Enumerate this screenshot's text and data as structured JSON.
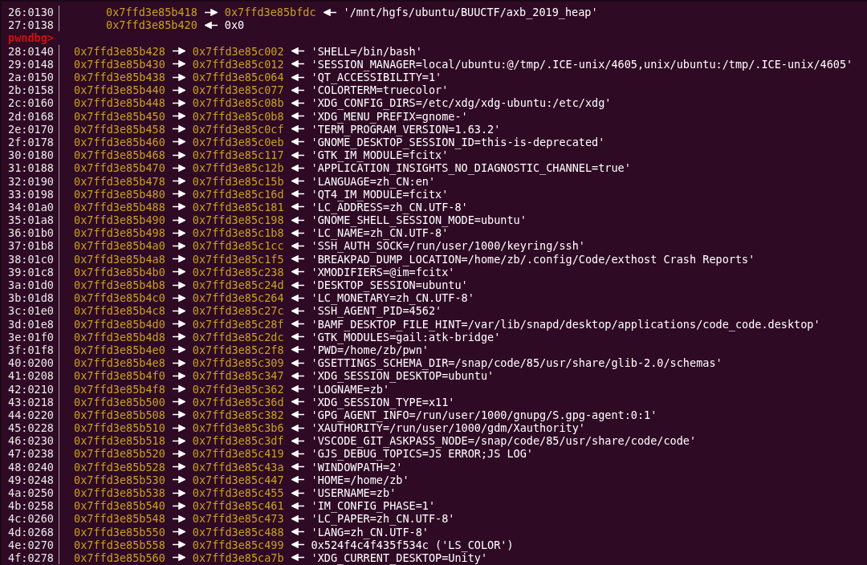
{
  "terminal": {
    "lines": [
      {
        "kind": "nested",
        "offset": "26:0130",
        "address": "0x7ffd3e85b418",
        "target": "0x7ffd3e85bfdc",
        "value": "'/mnt/hgfs/ubuntu/BUUCTF/axb_2019_heap'"
      },
      {
        "kind": "nested",
        "offset": "27:0138",
        "address": "0x7ffd3e85b420",
        "value": "0x0"
      },
      {
        "kind": "prompt",
        "text": "pwndbg>"
      },
      {
        "kind": "stack",
        "offset": "28:0140",
        "address": "0x7ffd3e85b428",
        "target": "0x7ffd3e85c002",
        "value": "'SHELL=/bin/bash'"
      },
      {
        "kind": "stack",
        "offset": "29:0148",
        "address": "0x7ffd3e85b430",
        "target": "0x7ffd3e85c012",
        "value": "'SESSION_MANAGER=local/ubuntu:@/tmp/.ICE-unix/4605,unix/ubuntu:/tmp/.ICE-unix/4605'"
      },
      {
        "kind": "stack",
        "offset": "2a:0150",
        "address": "0x7ffd3e85b438",
        "target": "0x7ffd3e85c064",
        "value": "'QT_ACCESSIBILITY=1'"
      },
      {
        "kind": "stack",
        "offset": "2b:0158",
        "address": "0x7ffd3e85b440",
        "target": "0x7ffd3e85c077",
        "value": "'COLORTERM=truecolor'"
      },
      {
        "kind": "stack",
        "offset": "2c:0160",
        "address": "0x7ffd3e85b448",
        "target": "0x7ffd3e85c08b",
        "value": "'XDG_CONFIG_DIRS=/etc/xdg/xdg-ubuntu:/etc/xdg'"
      },
      {
        "kind": "stack",
        "offset": "2d:0168",
        "address": "0x7ffd3e85b450",
        "target": "0x7ffd3e85c0b8",
        "value": "'XDG_MENU_PREFIX=gnome-'"
      },
      {
        "kind": "stack",
        "offset": "2e:0170",
        "address": "0x7ffd3e85b458",
        "target": "0x7ffd3e85c0cf",
        "value": "'TERM_PROGRAM_VERSION=1.63.2'"
      },
      {
        "kind": "stack",
        "offset": "2f:0178",
        "address": "0x7ffd3e85b460",
        "target": "0x7ffd3e85c0eb",
        "value": "'GNOME_DESKTOP_SESSION_ID=this-is-deprecated'"
      },
      {
        "kind": "stack",
        "offset": "30:0180",
        "address": "0x7ffd3e85b468",
        "target": "0x7ffd3e85c117",
        "value": "'GTK_IM_MODULE=fcitx'"
      },
      {
        "kind": "stack",
        "offset": "31:0188",
        "address": "0x7ffd3e85b470",
        "target": "0x7ffd3e85c12b",
        "value": "'APPLICATION_INSIGHTS_NO_DIAGNOSTIC_CHANNEL=true'"
      },
      {
        "kind": "stack",
        "offset": "32:0190",
        "address": "0x7ffd3e85b478",
        "target": "0x7ffd3e85c15b",
        "value": "'LANGUAGE=zh_CN:en'"
      },
      {
        "kind": "stack",
        "offset": "33:0198",
        "address": "0x7ffd3e85b480",
        "target": "0x7ffd3e85c16d",
        "value": "'QT4_IM_MODULE=fcitx'"
      },
      {
        "kind": "stack",
        "offset": "34:01a0",
        "address": "0x7ffd3e85b488",
        "target": "0x7ffd3e85c181",
        "value": "'LC_ADDRESS=zh_CN.UTF-8'"
      },
      {
        "kind": "stack",
        "offset": "35:01a8",
        "address": "0x7ffd3e85b490",
        "target": "0x7ffd3e85c198",
        "value": "'GNOME_SHELL_SESSION_MODE=ubuntu'"
      },
      {
        "kind": "stack",
        "offset": "36:01b0",
        "address": "0x7ffd3e85b498",
        "target": "0x7ffd3e85c1b8",
        "value": "'LC_NAME=zh_CN.UTF-8'"
      },
      {
        "kind": "stack",
        "offset": "37:01b8",
        "address": "0x7ffd3e85b4a0",
        "target": "0x7ffd3e85c1cc",
        "value": "'SSH_AUTH_SOCK=/run/user/1000/keyring/ssh'"
      },
      {
        "kind": "stack",
        "offset": "38:01c0",
        "address": "0x7ffd3e85b4a8",
        "target": "0x7ffd3e85c1f5",
        "value": "'BREAKPAD_DUMP_LOCATION=/home/zb/.config/Code/exthost Crash Reports'"
      },
      {
        "kind": "stack",
        "offset": "39:01c8",
        "address": "0x7ffd3e85b4b0",
        "target": "0x7ffd3e85c238",
        "value": "'XMODIFIERS=@im=fcitx'"
      },
      {
        "kind": "stack",
        "offset": "3a:01d0",
        "address": "0x7ffd3e85b4b8",
        "target": "0x7ffd3e85c24d",
        "value": "'DESKTOP_SESSION=ubuntu'"
      },
      {
        "kind": "stack",
        "offset": "3b:01d8",
        "address": "0x7ffd3e85b4c0",
        "target": "0x7ffd3e85c264",
        "value": "'LC_MONETARY=zh_CN.UTF-8'"
      },
      {
        "kind": "stack",
        "offset": "3c:01e0",
        "address": "0x7ffd3e85b4c8",
        "target": "0x7ffd3e85c27c",
        "value": "'SSH_AGENT_PID=4562'"
      },
      {
        "kind": "stack",
        "offset": "3d:01e8",
        "address": "0x7ffd3e85b4d0",
        "target": "0x7ffd3e85c28f",
        "value": "'BAMF_DESKTOP_FILE_HINT=/var/lib/snapd/desktop/applications/code_code.desktop'"
      },
      {
        "kind": "stack",
        "offset": "3e:01f0",
        "address": "0x7ffd3e85b4d8",
        "target": "0x7ffd3e85c2dc",
        "value": "'GTK_MODULES=gail:atk-bridge'"
      },
      {
        "kind": "stack",
        "offset": "3f:01f8",
        "address": "0x7ffd3e85b4e0",
        "target": "0x7ffd3e85c2f8",
        "value": "'PWD=/home/zb/pwn'"
      },
      {
        "kind": "stack",
        "offset": "40:0200",
        "address": "0x7ffd3e85b4e8",
        "target": "0x7ffd3e85c309",
        "value": "'GSETTINGS_SCHEMA_DIR=/snap/code/85/usr/share/glib-2.0/schemas'"
      },
      {
        "kind": "stack",
        "offset": "41:0208",
        "address": "0x7ffd3e85b4f0",
        "target": "0x7ffd3e85c347",
        "value": "'XDG_SESSION_DESKTOP=ubuntu'"
      },
      {
        "kind": "stack",
        "offset": "42:0210",
        "address": "0x7ffd3e85b4f8",
        "target": "0x7ffd3e85c362",
        "value": "'LOGNAME=zb'"
      },
      {
        "kind": "stack",
        "offset": "43:0218",
        "address": "0x7ffd3e85b500",
        "target": "0x7ffd3e85c36d",
        "value": "'XDG_SESSION_TYPE=x11'"
      },
      {
        "kind": "stack",
        "offset": "44:0220",
        "address": "0x7ffd3e85b508",
        "target": "0x7ffd3e85c382",
        "value": "'GPG_AGENT_INFO=/run/user/1000/gnupg/S.gpg-agent:0:1'"
      },
      {
        "kind": "stack",
        "offset": "45:0228",
        "address": "0x7ffd3e85b510",
        "target": "0x7ffd3e85c3b6",
        "value": "'XAUTHORITY=/run/user/1000/gdm/Xauthority'"
      },
      {
        "kind": "stack",
        "offset": "46:0230",
        "address": "0x7ffd3e85b518",
        "target": "0x7ffd3e85c3df",
        "value": "'VSCODE_GIT_ASKPASS_NODE=/snap/code/85/usr/share/code/code'"
      },
      {
        "kind": "stack",
        "offset": "47:0238",
        "address": "0x7ffd3e85b520",
        "target": "0x7ffd3e85c419",
        "value": "'GJS_DEBUG_TOPICS=JS ERROR;JS LOG'"
      },
      {
        "kind": "stack",
        "offset": "48:0240",
        "address": "0x7ffd3e85b528",
        "target": "0x7ffd3e85c43a",
        "value": "'WINDOWPATH=2'"
      },
      {
        "kind": "stack",
        "offset": "49:0248",
        "address": "0x7ffd3e85b530",
        "target": "0x7ffd3e85c447",
        "value": "'HOME=/home/zb'"
      },
      {
        "kind": "stack",
        "offset": "4a:0250",
        "address": "0x7ffd3e85b538",
        "target": "0x7ffd3e85c455",
        "value": "'USERNAME=zb'"
      },
      {
        "kind": "stack",
        "offset": "4b:0258",
        "address": "0x7ffd3e85b540",
        "target": "0x7ffd3e85c461",
        "value": "'IM_CONFIG_PHASE=1'"
      },
      {
        "kind": "stack",
        "offset": "4c:0260",
        "address": "0x7ffd3e85b548",
        "target": "0x7ffd3e85c473",
        "value": "'LC_PAPER=zh_CN.UTF-8'"
      },
      {
        "kind": "stack",
        "offset": "4d:0268",
        "address": "0x7ffd3e85b550",
        "target": "0x7ffd3e85c488",
        "value": "'LANG=zh_CN.UTF-8'"
      },
      {
        "kind": "stack",
        "offset": "4e:0270",
        "address": "0x7ffd3e85b558",
        "target": "0x7ffd3e85c499",
        "value": "0x524f4c4f435f534c ('LS_COLOR')"
      },
      {
        "kind": "stack",
        "offset": "4f:0278",
        "address": "0x7ffd3e85b560",
        "target": "0x7ffd3e85ca7b",
        "value": "'XDG_CURRENT_DESKTOP=Unity'"
      }
    ]
  }
}
